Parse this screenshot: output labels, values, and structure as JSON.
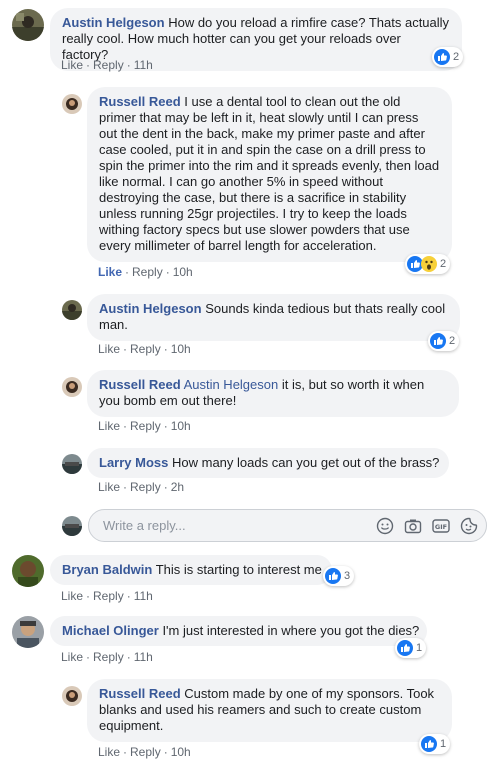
{
  "placeholder": "Write a reply...",
  "like_label": "Like",
  "reply_label": "Reply",
  "comments": [
    {
      "name": "Austin Helgeson",
      "text": "How do you reload a rimfire case? Thats actually really cool. How much hotter can you get your reloads over factory?",
      "time": "11h",
      "reactions": "2"
    },
    {
      "name": "Russell Reed",
      "text": "I use a dental tool to clean out the old primer that may be left in it, heat slowly until I can press out the dent in the back, make my primer paste and after case cooled, put it in and spin the case on a drill press to spin the primer into the rim and it spreads evenly, then load like normal. I can go another 5% in speed without destroying the case, but there is a sacrifice in stability unless running 25gr projectiles. I try to keep the loads withing factory specs but use slower powders that use every millimeter of barrel length for acceleration.",
      "time": "10h",
      "reactions": "2"
    },
    {
      "name": "Austin Helgeson",
      "text": "Sounds kinda tedious but thats really cool man.",
      "time": "10h",
      "reactions": "2"
    },
    {
      "name": "Russell Reed",
      "tag": "Austin Helgeson",
      "text": "it is, but so worth it when you bomb em out there!",
      "time": "10h"
    },
    {
      "name": "Larry Moss",
      "text": "How many loads can you get out of the brass?",
      "time": "2h"
    },
    {
      "name": "Bryan Baldwin",
      "text": "This is starting to interest me",
      "time": "11h",
      "reactions": "3"
    },
    {
      "name": "Michael Olinger",
      "text": "I'm just interested in where you got the dies?",
      "time": "11h",
      "reactions": "1"
    },
    {
      "name": "Russell Reed",
      "text": "Custom made by one of my sponsors. Took blanks and used his reamers and such to create custom equipment.",
      "time": "10h",
      "reactions": "1"
    }
  ],
  "colors": {
    "link": "#385898",
    "bubble": "#f2f3f5",
    "like_blue": "#1877f2",
    "meta": "#606770"
  }
}
